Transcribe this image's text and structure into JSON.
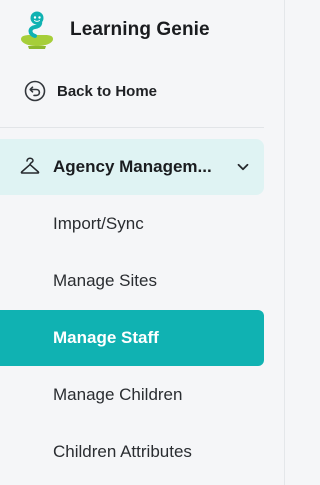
{
  "brand": {
    "name": "Learning Genie",
    "logo_icon": "learning-genie-logo"
  },
  "back_home": {
    "label": "Back to Home",
    "icon": "back-arrow-circle-icon"
  },
  "nav_group": {
    "label": "Agency Managem...",
    "icon": "hanger-icon",
    "expanded": true,
    "chevron_icon": "chevron-down-icon"
  },
  "nav_items": [
    {
      "label": "Import/Sync",
      "active": false
    },
    {
      "label": "Manage Sites",
      "active": false
    },
    {
      "label": "Manage Staff",
      "active": true
    },
    {
      "label": "Manage Children",
      "active": false
    },
    {
      "label": "Children Attributes",
      "active": false
    }
  ],
  "colors": {
    "accent": "#10B2B2",
    "group_highlight": "#DFF3F3",
    "sidebar_bg": "#F5F6F8",
    "text": "#1F2124"
  }
}
